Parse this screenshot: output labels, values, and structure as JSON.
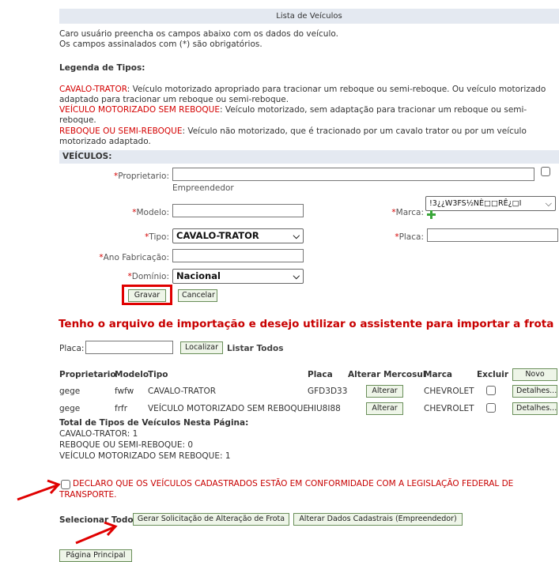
{
  "page_title": "Lista de Veículos",
  "intro": {
    "line1": "Caro usuário preencha os campos abaixo com os dados do veículo.",
    "line2": "Os campos assinalados com (*) são obrigatórios."
  },
  "legend": {
    "heading": "Legenda de Tipos:",
    "cavalo_term": "CAVALO-TRATOR",
    "cavalo_line1": ": Veículo motorizado apropriado para tracionar um reboque ou semi-reboque. Ou veículo motorizado",
    "cavalo_line2": "adaptado para tracionar um reboque ou semi-reboque.",
    "motorizado_term": "VEÍCULO MOTORIZADO SEM REBOQUE",
    "motorizado_line1": ": Veículo motorizado, sem adaptação para tracionar um reboque ou semi-",
    "motorizado_line2": "reboque.",
    "reboque_term": "REBOQUE OU SEMI-REBOQUE",
    "reboque_line1": ": Veículo não motorizado, que é tracionado por um cavalo trator ou por um veículo",
    "reboque_line2": "motorizado adaptado."
  },
  "section_title": "VEÍCULOS:",
  "form": {
    "required_mark": "*",
    "proprietario_label": "Proprietario:",
    "proprietario_value": "",
    "empreendedor_label": "Empreendedor",
    "modelo_label": "Modelo:",
    "modelo_value": "",
    "marca_label": "Marca:",
    "marca_value": "!3¿¿W3FS½NÈ□□RÊ¿□I",
    "tipo_label": "Tipo:",
    "tipo_value": "CAVALO-TRATOR",
    "placa_label": "Placa:",
    "placa_value": "",
    "ano_label": "Ano Fabricação:",
    "ano_value": "",
    "dominio_label": "Domínio:",
    "dominio_value": "Nacional",
    "gravar_label": "Gravar",
    "cancelar_label": "Cancelar"
  },
  "import_link": "Tenho o arquivo de importação e desejo utilizar o assistente para importar a frota",
  "search": {
    "placa_label": "Placa:",
    "placa_value": "",
    "localizar_label": "Localizar",
    "listar_todos_label": "Listar Todos"
  },
  "table": {
    "headers": {
      "proprietario": "Proprietario",
      "modelo": "Modelo",
      "tipo": "Tipo",
      "placa": "Placa",
      "alterar_mercosul": "Alterar Mercosul",
      "marca": "Marca",
      "excluir": "Excluir"
    },
    "novo_label": "Novo",
    "alterar_label": "Alterar",
    "detalhes_label": "Detalhes...",
    "rows": [
      {
        "proprietario": "gege",
        "modelo": "fwfw",
        "tipo": "CAVALO-TRATOR",
        "placa": "GFD3D33",
        "marca": "CHEVROLET"
      },
      {
        "proprietario": "gege",
        "modelo": "frfr",
        "tipo": "VEÍCULO MOTORIZADO SEM REBOQUE",
        "placa": "HIU8I88",
        "marca": "CHEVROLET"
      }
    ]
  },
  "totals": {
    "heading": "Total de Tipos de Veículos Nesta Página:",
    "cavalo": "CAVALO-TRATOR: 1",
    "reboque": "REBOQUE OU SEMI-REBOQUE: 0",
    "motorizado": "VEÍCULO MOTORIZADO SEM REBOQUE: 1"
  },
  "declaration": {
    "line1": "DECLARO QUE OS VEÍCULOS CADASTRADOS ESTÃO EM CONFORMIDADE COM A LEGISLAÇÃO FEDERAL DE",
    "line2": "TRANSPORTE."
  },
  "footer": {
    "selecionar_todos": "Selecionar Todos",
    "gerar_label": "Gerar Solicitação de Alteração de Frota",
    "alterar_dados_label": "Alterar Dados Cadastrais (Empreendedor)",
    "pagina_principal_label": "Página Principal"
  },
  "colors": {
    "required_red": "#d40000",
    "header_bar": "#e4e9f1",
    "button_border": "#6a8f5a",
    "button_bg": "#eef5e8",
    "highlight_red": "#e00000",
    "plus_green": "#3aa63a"
  }
}
